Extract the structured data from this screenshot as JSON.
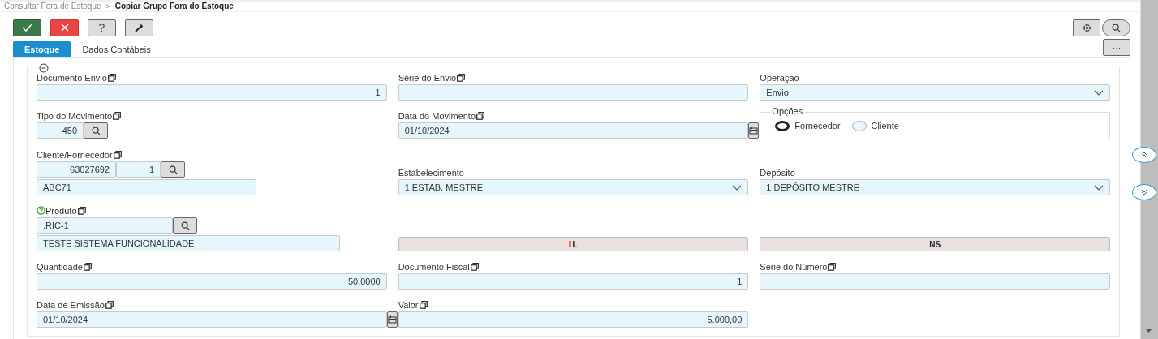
{
  "breadcrumb": {
    "items": [
      "Consultar Fora de Estoque",
      "Copiar Grupo Fora do Estoque"
    ],
    "separator": ">"
  },
  "toolbar": [
    {
      "kind": "confirm"
    },
    {
      "kind": "cancel"
    },
    {
      "kind": "help",
      "label": "?"
    },
    {
      "kind": "tools"
    }
  ],
  "top_right": [
    {
      "kind": "settings"
    },
    {
      "kind": "search"
    }
  ],
  "more_button": {
    "label": "···"
  },
  "tabs": [
    {
      "label": "Estoque",
      "selected": true
    },
    {
      "label": "Dados Contábeis",
      "selected": false
    }
  ],
  "form": {
    "expanded": true,
    "rows": [
      {
        "cells": [
          {
            "kind": "input",
            "label": "Documento Envio",
            "copyable": true,
            "value": "1"
          },
          {
            "kind": "input",
            "label": "Série do Envio",
            "copyable": true
          },
          {
            "kind": "select",
            "label": "Operação",
            "copyable": false,
            "value": "Envio"
          }
        ]
      },
      {
        "cells": [
          {
            "kind": "lookup",
            "label": "Tipo do Movimento",
            "copyable": true,
            "parts": [
              {
                "kind": "number",
                "value": "450"
              }
            ]
          },
          {
            "kind": "date",
            "label": "Data do Movimento",
            "copyable": true,
            "value": "01/10/2024"
          },
          {
            "kind": "radio_group",
            "legend": "Opções",
            "options": [
              {
                "label": "Fornecedor",
                "selected": true
              },
              {
                "label": "Cliente",
                "selected": false
              }
            ]
          }
        ]
      },
      {
        "cells": [
          {
            "kind": "lookup",
            "label": "Cliente/Fornecedor",
            "copyable": true,
            "parts": [
              {
                "kind": "number",
                "value": "63027692"
              },
              {
                "kind": "number",
                "value": "1"
              }
            ],
            "description": "ABC71"
          },
          {
            "kind": "select",
            "label": "Estabelecimento",
            "copyable": false,
            "value": "1 ESTAB. MESTRE"
          },
          {
            "kind": "select",
            "label": "Depósito",
            "copyable": false,
            "value": "1 DEPÓSITO MESTRE"
          }
        ]
      },
      {
        "cells": [
          {
            "kind": "lookup",
            "label": "Produto",
            "hint": true,
            "copyable": true,
            "parts": [
              {
                "kind": "code",
                "value": ".RIC-1"
              }
            ],
            "description": "TESTE SISTEMA FUNCIONALIDADE"
          },
          {
            "kind": "status",
            "text": "L",
            "flagged": true
          },
          {
            "kind": "status",
            "text": "NS",
            "flagged": false
          }
        ]
      },
      {
        "cells": [
          {
            "kind": "input",
            "label": "Quantidade",
            "copyable": true,
            "value": "50,0000"
          },
          {
            "kind": "input",
            "label": "Documento Fiscal",
            "copyable": true,
            "value": "1"
          },
          {
            "kind": "input",
            "label": "Série do Número",
            "copyable": true
          }
        ]
      },
      {
        "cells": [
          {
            "kind": "date",
            "label": "Data de Emissão",
            "copyable": true,
            "value": "01/10/2024"
          },
          {
            "kind": "input",
            "label": "Valor",
            "copyable": true,
            "value": "5.000,00"
          },
          {
            "kind": "empty"
          }
        ]
      }
    ]
  }
}
